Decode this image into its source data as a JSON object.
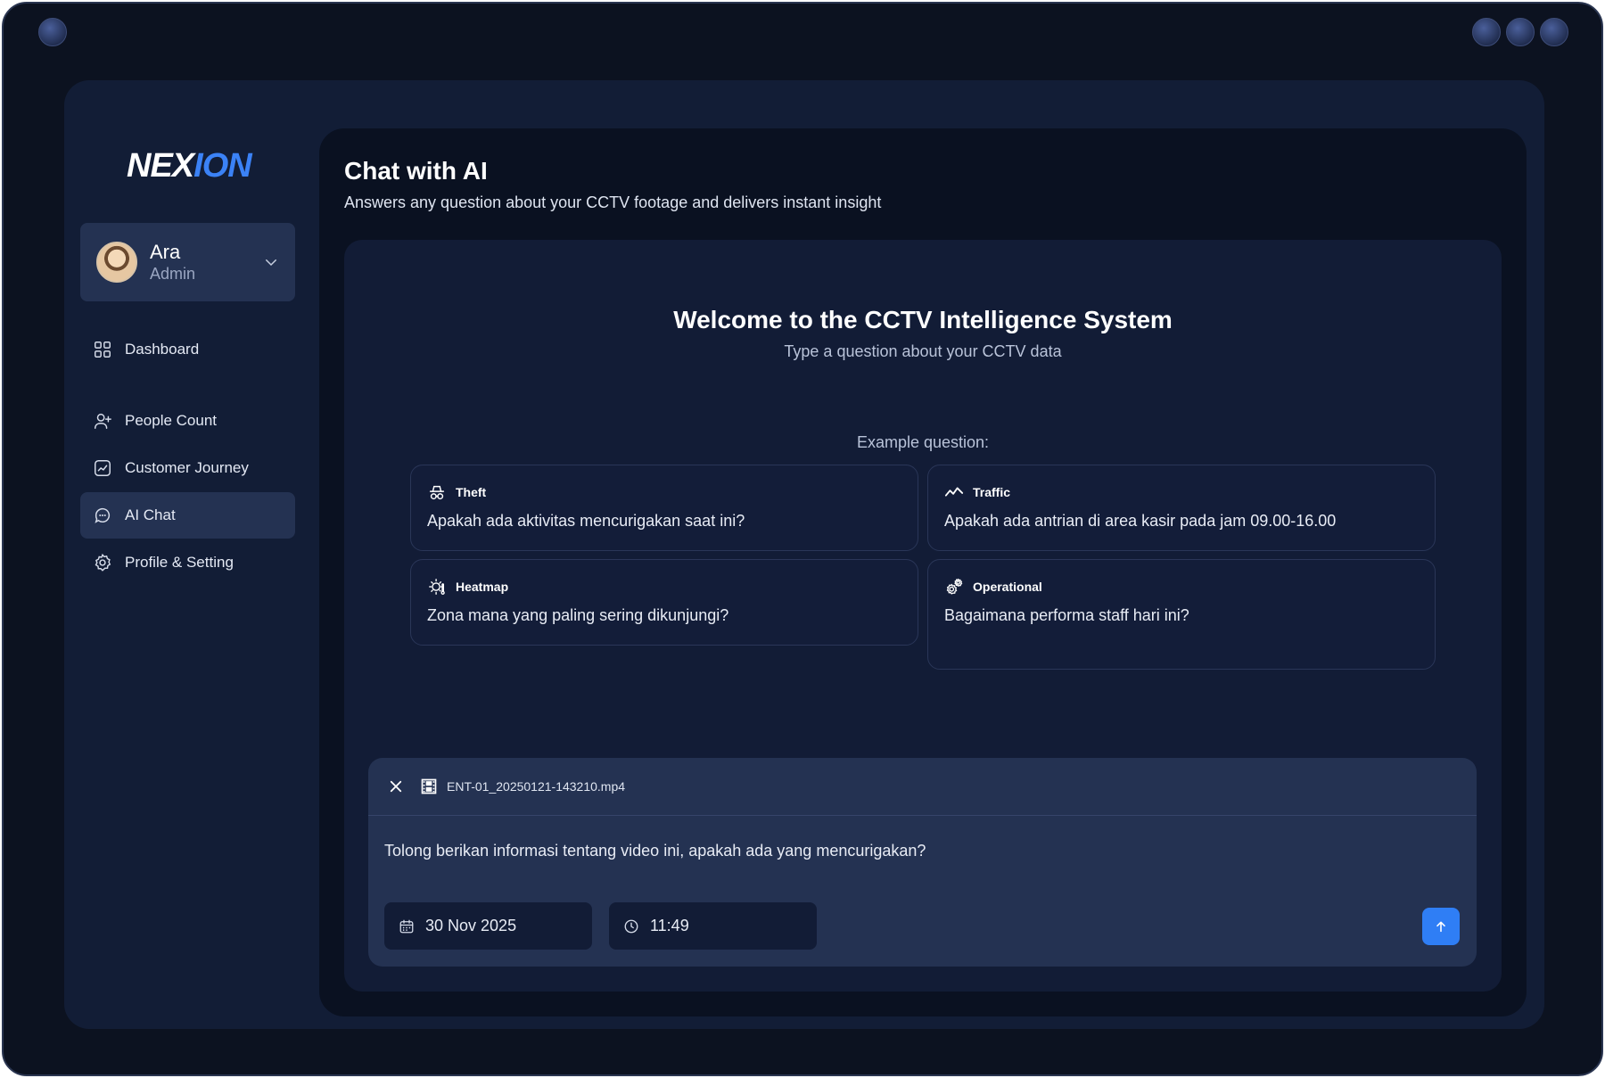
{
  "brand": {
    "logo_part1": "NEX",
    "logo_part2": "ION"
  },
  "user": {
    "name": "Ara",
    "role": "Admin"
  },
  "nav": [
    {
      "label": "Dashboard",
      "icon": "grid-icon",
      "active": false
    },
    {
      "label": "People Count",
      "icon": "user-plus-icon",
      "active": false
    },
    {
      "label": "Customer Journey",
      "icon": "trend-chart-icon",
      "active": false
    },
    {
      "label": "AI Chat",
      "icon": "chat-bubble-icon",
      "active": true
    },
    {
      "label": "Profile & Setting",
      "icon": "gear-icon",
      "active": false
    }
  ],
  "page": {
    "title": "Chat with AI",
    "subtitle": "Answers any question about your CCTV footage and delivers instant insight"
  },
  "welcome": {
    "title": "Welcome to the CCTV Intelligence System",
    "subtitle": "Type a question about your CCTV data",
    "example_label": "Example question:"
  },
  "examples": [
    {
      "category": "Theft",
      "icon": "spy-icon",
      "question": "Apakah ada aktivitas mencurigakan saat ini?"
    },
    {
      "category": "Traffic",
      "icon": "activity-line-icon",
      "question": "Apakah ada antrian di area kasir pada jam 09.00-16.00"
    },
    {
      "category": "Heatmap",
      "icon": "heat-sun-icon",
      "question": "Zona mana yang paling sering dikunjungi?"
    },
    {
      "category": "Operational",
      "icon": "cogs-icon",
      "question": "Bagaimana performa staff hari ini?"
    }
  ],
  "composer": {
    "attachment_name": "ENT-01_20250121-143210.mp4",
    "prompt": "Tolong berikan informasi tentang video ini, apakah ada yang mencurigakan?",
    "date": "30 Nov 2025",
    "time": "11:49"
  },
  "colors": {
    "accent": "#3b82f6",
    "send_button": "#2f7ef5",
    "active_nav": "#243252"
  }
}
